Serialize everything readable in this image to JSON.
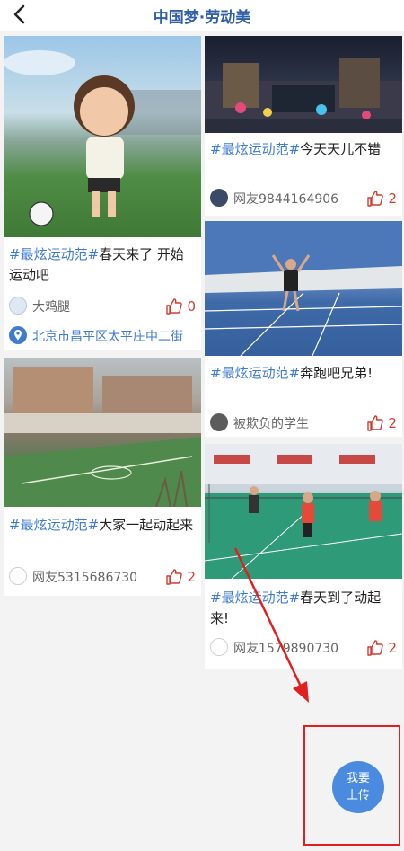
{
  "header": {
    "title": "中国梦·劳动美"
  },
  "icons": {
    "back": "chevron-left-icon",
    "like": "thumbs-up-icon",
    "location": "location-pin-icon"
  },
  "colors": {
    "accent": "#3e7bd1",
    "like": "#d43b2e",
    "annotation": "#e02020"
  },
  "posts": [
    {
      "tag": "#最炫运动范#",
      "text": "春天来了 开始运动吧",
      "user": "大鸡腿",
      "likes": "0",
      "location": "北京市昌平区太平庄中二街"
    },
    {
      "tag": "#最炫运动范#",
      "text": "今天天儿不错",
      "user": "网友9844164906",
      "likes": "2"
    },
    {
      "tag": "#最炫运动范#",
      "text": "大家一起动起来",
      "user": "网友5315686730",
      "likes": "2"
    },
    {
      "tag": "#最炫运动范#",
      "text": "奔跑吧兄弟!",
      "user": "被欺负的学生",
      "likes": "2"
    },
    {
      "tag": "#最炫运动范#",
      "text": "春天到了动起来!",
      "user": "网友1579890730",
      "likes": "2"
    }
  ],
  "upload_button": {
    "line1": "我要",
    "line2": "上传"
  }
}
